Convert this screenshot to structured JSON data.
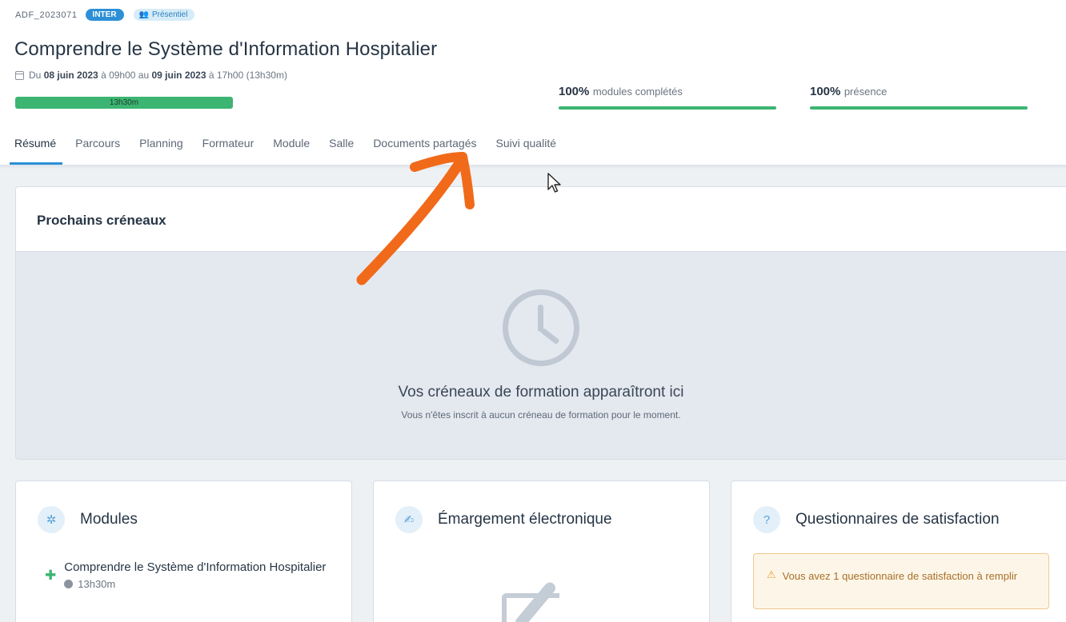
{
  "header": {
    "ref_code": "ADF_2023071",
    "badge_type": "INTER",
    "badge_mode": "Présentiel",
    "title": "Comprendre le Système d'Information Hospitalier",
    "dates": {
      "prefix": "Du",
      "start_date": "08 juin 2023",
      "start_time": "à 09h00 au",
      "end_date": "09 juin 2023",
      "end_time": "à 17h00 (13h30m)"
    },
    "duration_label": "13h30m",
    "stats": {
      "modules": {
        "value": "100%",
        "label": "modules complétés",
        "fraction": 1.0
      },
      "presence": {
        "value": "100%",
        "label": "présence",
        "fraction": 1.0
      }
    }
  },
  "tabs": [
    {
      "label": "Résumé",
      "active": true
    },
    {
      "label": "Parcours",
      "active": false
    },
    {
      "label": "Planning",
      "active": false
    },
    {
      "label": "Formateur",
      "active": false
    },
    {
      "label": "Module",
      "active": false
    },
    {
      "label": "Salle",
      "active": false
    },
    {
      "label": "Documents partagés",
      "active": false
    },
    {
      "label": "Suivi qualité",
      "active": false
    }
  ],
  "creneaux": {
    "title": "Prochains créneaux",
    "empty_title": "Vos créneaux de formation apparaîtront ici",
    "empty_subtitle": "Vous n'êtes inscrit à aucun créneau de formation pour le moment."
  },
  "cards": {
    "modules": {
      "title": "Modules",
      "item_name": "Comprendre le Système d'Information Hospitalier",
      "item_duration": "13h30m"
    },
    "emargement": {
      "title": "Émargement électronique"
    },
    "questionnaires": {
      "title": "Questionnaires de satisfaction",
      "warning": "Vous avez 1 questionnaire de satisfaction à remplir"
    }
  },
  "colors": {
    "accent": "#2d8fd6",
    "success": "#3cb572",
    "annotation_arrow": "#f06a1a",
    "warning_bg": "#fdf6e8"
  }
}
